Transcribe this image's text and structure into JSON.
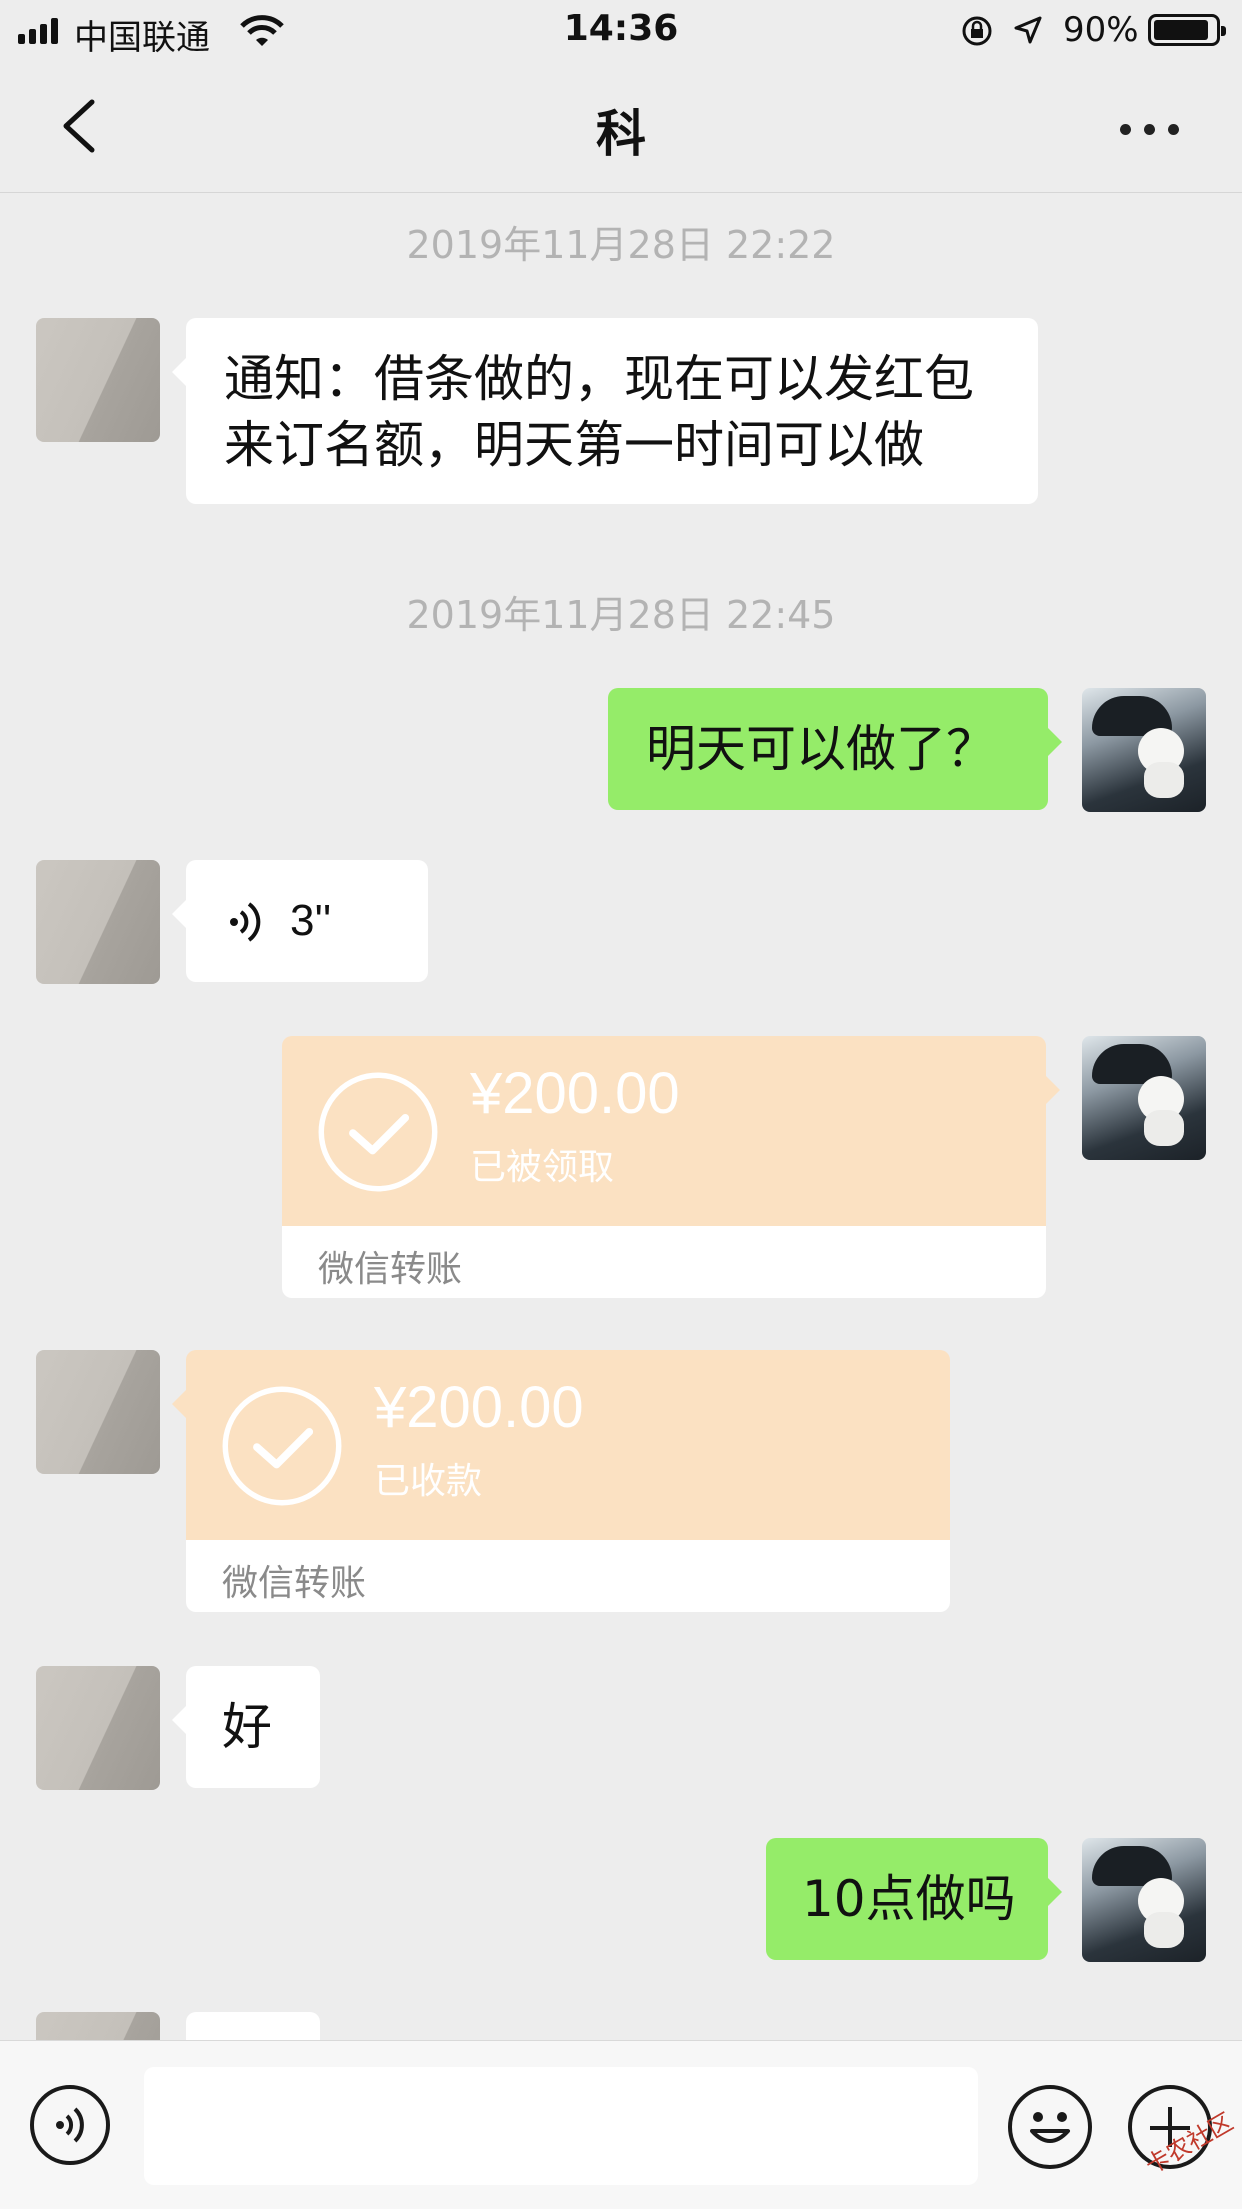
{
  "status_bar": {
    "carrier": "中国联通",
    "time": "14:36",
    "battery_percent": "90%",
    "battery_level": 0.9,
    "icons": [
      "signal-icon",
      "wifi-icon",
      "orientation-lock-icon",
      "location-icon",
      "battery-icon"
    ]
  },
  "nav": {
    "title": "科",
    "back_icon": "back-chevron-icon",
    "more_icon": "more-icon"
  },
  "messages": {
    "ts1": "2019年11月28日 22:22",
    "m1_text_line1": "通知：借条做的，现在可以发红包",
    "m1_text_line2": "来订名额，明天第一时间可以做",
    "ts2": "2019年11月28日 22:45",
    "m2_text": "明天可以做了？",
    "m3_voice_duration": "3''",
    "m4_amount": "¥200.00",
    "m4_status": "已被领取",
    "m4_label": "微信转账",
    "m5_amount": "¥200.00",
    "m5_status": "已收款",
    "m5_label": "微信转账",
    "m6_text": "好",
    "m7_text": "10点做吗"
  },
  "colors": {
    "background": "#ededed",
    "sent_bubble": "#95ec69",
    "received_bubble": "#ffffff",
    "transfer_card": "#fbe1c2"
  },
  "input_bar": {
    "icons": [
      "voice-input-icon",
      "emoji-icon",
      "plus-icon"
    ]
  },
  "watermark": "卡农社区"
}
